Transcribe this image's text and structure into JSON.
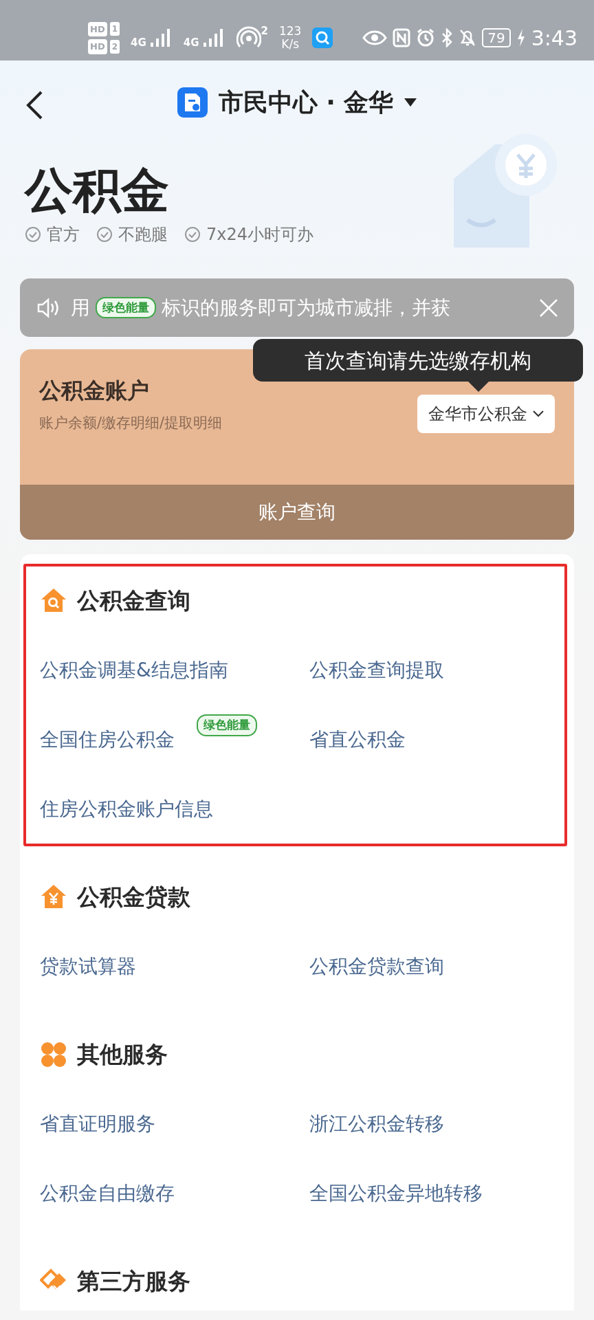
{
  "status_bar": {
    "sim": [
      {
        "label": "HD",
        "slot": "1"
      },
      {
        "label": "HD",
        "slot": "2"
      }
    ],
    "networks": [
      "4G",
      "4G"
    ],
    "hotspot_count": "2",
    "speed": "123",
    "speed_unit": "K/s",
    "battery": "79",
    "time": "3:43"
  },
  "header": {
    "title": "市民中心 · 金华"
  },
  "hero": {
    "title": "公积金",
    "features": [
      "官方",
      "不跑腿",
      "7x24小时可办"
    ]
  },
  "notice": {
    "segments": [
      {
        "kind": "text",
        "text": "用"
      },
      {
        "kind": "tag",
        "text": "绿色能量"
      },
      {
        "kind": "text",
        "text": "标识的服务即可为城市减排，并获"
      }
    ]
  },
  "tooltip": {
    "text": "首次查询请先选缴存机构"
  },
  "account": {
    "title": "公积金账户",
    "subtitle": "账户余额/缴存明细/提取明细",
    "institution": "金华市公积金",
    "action": "账户查询"
  },
  "sections": [
    {
      "title": "公积金查询",
      "highlighted": true,
      "items": [
        {
          "label": "公积金调基&结息指南"
        },
        {
          "label": "公积金查询提取"
        },
        {
          "label": "全国住房公积金",
          "tag": "绿色能量"
        },
        {
          "label": "省直公积金"
        },
        {
          "label": "住房公积金账户信息"
        }
      ]
    },
    {
      "title": "公积金贷款",
      "highlighted": false,
      "items": [
        {
          "label": "贷款试算器"
        },
        {
          "label": "公积金贷款查询"
        }
      ]
    },
    {
      "title": "其他服务",
      "highlighted": false,
      "items": [
        {
          "label": "省直证明服务"
        },
        {
          "label": "浙江公积金转移"
        },
        {
          "label": "公积金自由缴存"
        },
        {
          "label": "全国公积金异地转移"
        }
      ]
    },
    {
      "title": "第三方服务",
      "highlighted": false
    }
  ]
}
